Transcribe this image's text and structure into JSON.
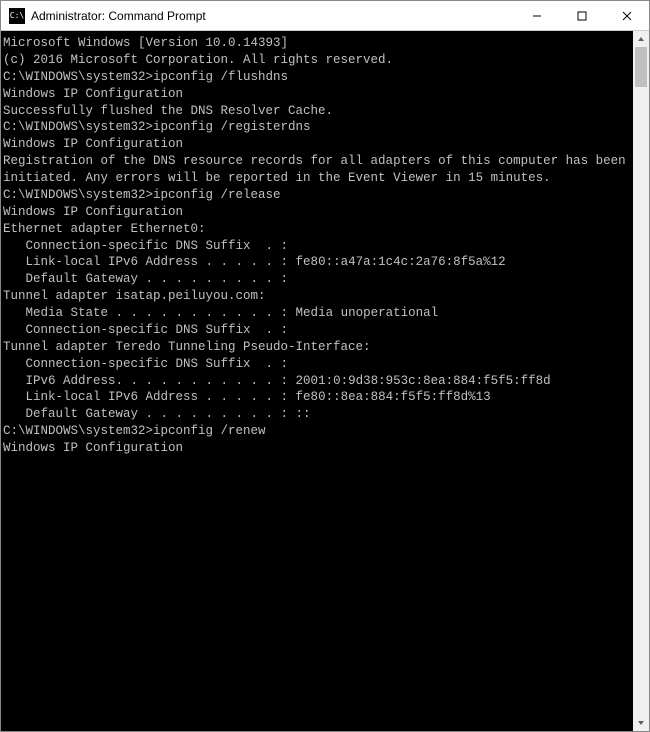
{
  "window": {
    "title": "Administrator: Command Prompt",
    "icon_label": "C:\\"
  },
  "terminal": {
    "lines": [
      "Microsoft Windows [Version 10.0.14393]",
      "(c) 2016 Microsoft Corporation. All rights reserved.",
      "",
      "C:\\WINDOWS\\system32>ipconfig /flushdns",
      "",
      "Windows IP Configuration",
      "",
      "Successfully flushed the DNS Resolver Cache.",
      "",
      "C:\\WINDOWS\\system32>ipconfig /registerdns",
      "",
      "Windows IP Configuration",
      "",
      "Registration of the DNS resource records for all adapters of this computer has been initiated. Any errors will be reported in the Event Viewer in 15 minutes.",
      "",
      "C:\\WINDOWS\\system32>ipconfig /release",
      "",
      "Windows IP Configuration",
      "",
      "",
      "Ethernet adapter Ethernet0:",
      "",
      "   Connection-specific DNS Suffix  . :",
      "   Link-local IPv6 Address . . . . . : fe80::a47a:1c4c:2a76:8f5a%12",
      "   Default Gateway . . . . . . . . . :",
      "",
      "Tunnel adapter isatap.peiluyou.com:",
      "",
      "   Media State . . . . . . . . . . . : Media unoperational",
      "   Connection-specific DNS Suffix  . :",
      "",
      "Tunnel adapter Teredo Tunneling Pseudo-Interface:",
      "",
      "   Connection-specific DNS Suffix  . :",
      "   IPv6 Address. . . . . . . . . . . : 2001:0:9d38:953c:8ea:884:f5f5:ff8d",
      "   Link-local IPv6 Address . . . . . : fe80::8ea:884:f5f5:ff8d%13",
      "   Default Gateway . . . . . . . . . : ::",
      "",
      "C:\\WINDOWS\\system32>ipconfig /renew",
      "",
      "Windows IP Configuration"
    ]
  }
}
